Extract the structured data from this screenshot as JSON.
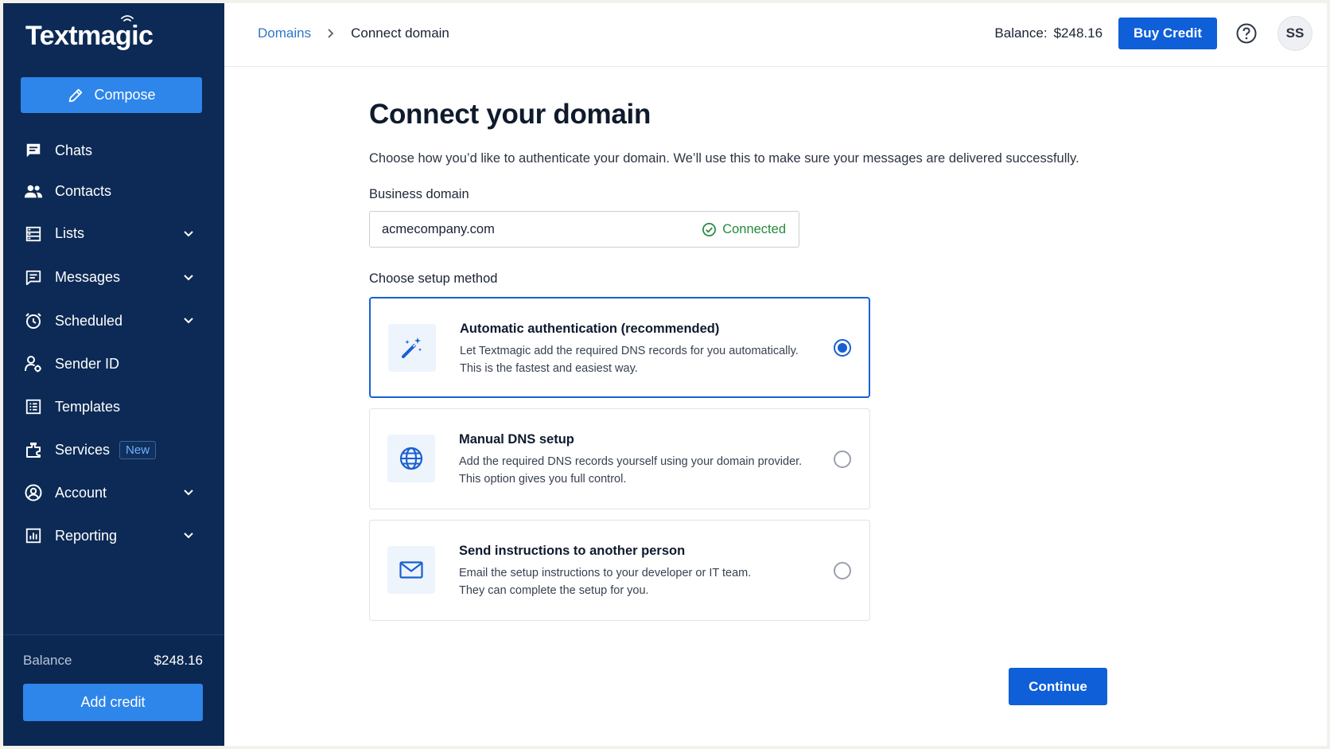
{
  "app": {
    "logo_text": "Textmagic"
  },
  "sidebar": {
    "compose_label": "Compose",
    "items": [
      {
        "label": "Chats",
        "icon": "chat-icon"
      },
      {
        "label": "Contacts",
        "icon": "contacts-icon"
      },
      {
        "label": "Lists",
        "icon": "lists-icon",
        "expandable": true
      },
      {
        "label": "Messages",
        "icon": "messages-icon",
        "expandable": true
      },
      {
        "label": "Scheduled",
        "icon": "alarm-clock-icon",
        "expandable": true
      },
      {
        "label": "Sender ID",
        "icon": "sender-id-icon"
      },
      {
        "label": "Templates",
        "icon": "templates-icon"
      },
      {
        "label": "Services",
        "icon": "services-icon",
        "badge": "New"
      },
      {
        "label": "Account",
        "icon": "account-icon",
        "expandable": true
      },
      {
        "label": "Reporting",
        "icon": "reporting-icon",
        "expandable": true
      }
    ],
    "balance_label": "Balance",
    "balance_value": "$248.16",
    "add_credit_label": "Add credit"
  },
  "header": {
    "breadcrumb": {
      "parent": "Domains",
      "current": "Connect domain"
    },
    "balance_label": "Balance:",
    "balance_value": "$248.16",
    "buy_credit_label": "Buy Credit",
    "avatar_initials": "SS"
  },
  "main": {
    "title": "Connect your domain",
    "subtitle": "Choose how you’d like to authenticate your domain. We’ll use this to make sure your messages are delivered successfully.",
    "domain_field": {
      "label": "Business domain",
      "value": "acmecompany.com",
      "status": "Connected"
    },
    "method_label": "Choose setup method",
    "options": [
      {
        "title": "Automatic authentication (recommended)",
        "desc_line1": "Let Textmagic add the required DNS records for you automatically.",
        "desc_line2": "This is the fastest and easiest way.",
        "icon": "magic-wand-icon",
        "selected": true
      },
      {
        "title": "Manual DNS setup",
        "desc_line1": "Add the required DNS records yourself using your domain provider.",
        "desc_line2": "This option gives you full control.",
        "icon": "globe-icon",
        "selected": false
      },
      {
        "title": "Send instructions to another person",
        "desc_line1": "Email the setup instructions to your developer or IT team.",
        "desc_line2": "They can complete the setup for you.",
        "icon": "envelope-icon",
        "selected": false
      }
    ],
    "continue_label": "Continue"
  },
  "colors": {
    "sidebar_bg": "#0c2a55",
    "primary_button": "#0e5fd8",
    "compose_button": "#2e85ea",
    "success": "#228b3c",
    "link": "#2e77c9"
  }
}
